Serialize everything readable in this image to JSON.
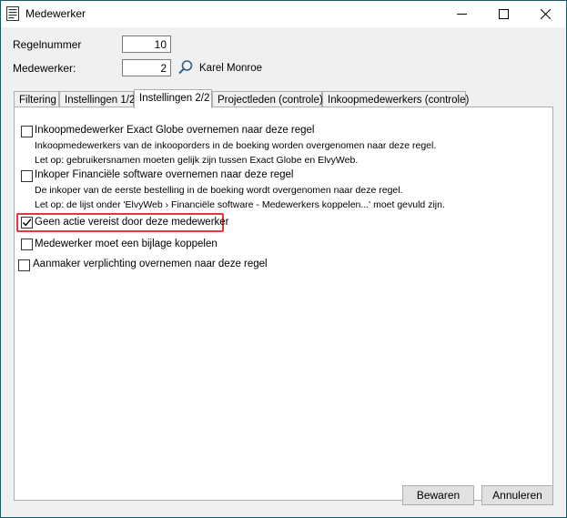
{
  "window": {
    "title": "Medewerker"
  },
  "form": {
    "regelnummer_label": "Regelnummer",
    "regelnummer_value": "10",
    "medewerker_label": "Medewerker:",
    "medewerker_value": "2",
    "medewerker_name": "Karel Monroe"
  },
  "tabs": [
    {
      "label": "Filtering"
    },
    {
      "label": "Instellingen 1/2"
    },
    {
      "label": "Instellingen 2/2",
      "active": true
    },
    {
      "label": "Projectleden (controle)"
    },
    {
      "label": "Inkoopmedewerkers (controle)"
    }
  ],
  "options": [
    {
      "label": "Inkoopmedewerker Exact Globe overnemen naar deze regel",
      "checked": false,
      "desc1": "Inkoopmedewerkers van de inkooporders in de boeking worden overgenomen naar deze regel.",
      "desc2": "Let op: gebruikersnamen moeten gelijk zijn tussen Exact Globe en ElvyWeb."
    },
    {
      "label": "Inkoper Financiële software overnemen naar deze regel",
      "checked": false,
      "desc1": "De inkoper van de eerste bestelling in de boeking wordt overgenomen naar deze regel.",
      "desc2": "Let op: de lijst onder 'ElvyWeb › Financiële software - Medewerkers koppelen...' moet gevuld zijn."
    },
    {
      "label": "Geen actie vereist door deze medewerker",
      "checked": true
    },
    {
      "label": "Medewerker moet een bijlage koppelen",
      "checked": false
    },
    {
      "label": "Aanmaker verplichting overnemen naar deze regel",
      "checked": false
    }
  ],
  "buttons": {
    "save": "Bewaren",
    "cancel": "Annuleren"
  },
  "colors": {
    "highlight": "#e0393e",
    "title_border": "#1e5662"
  }
}
